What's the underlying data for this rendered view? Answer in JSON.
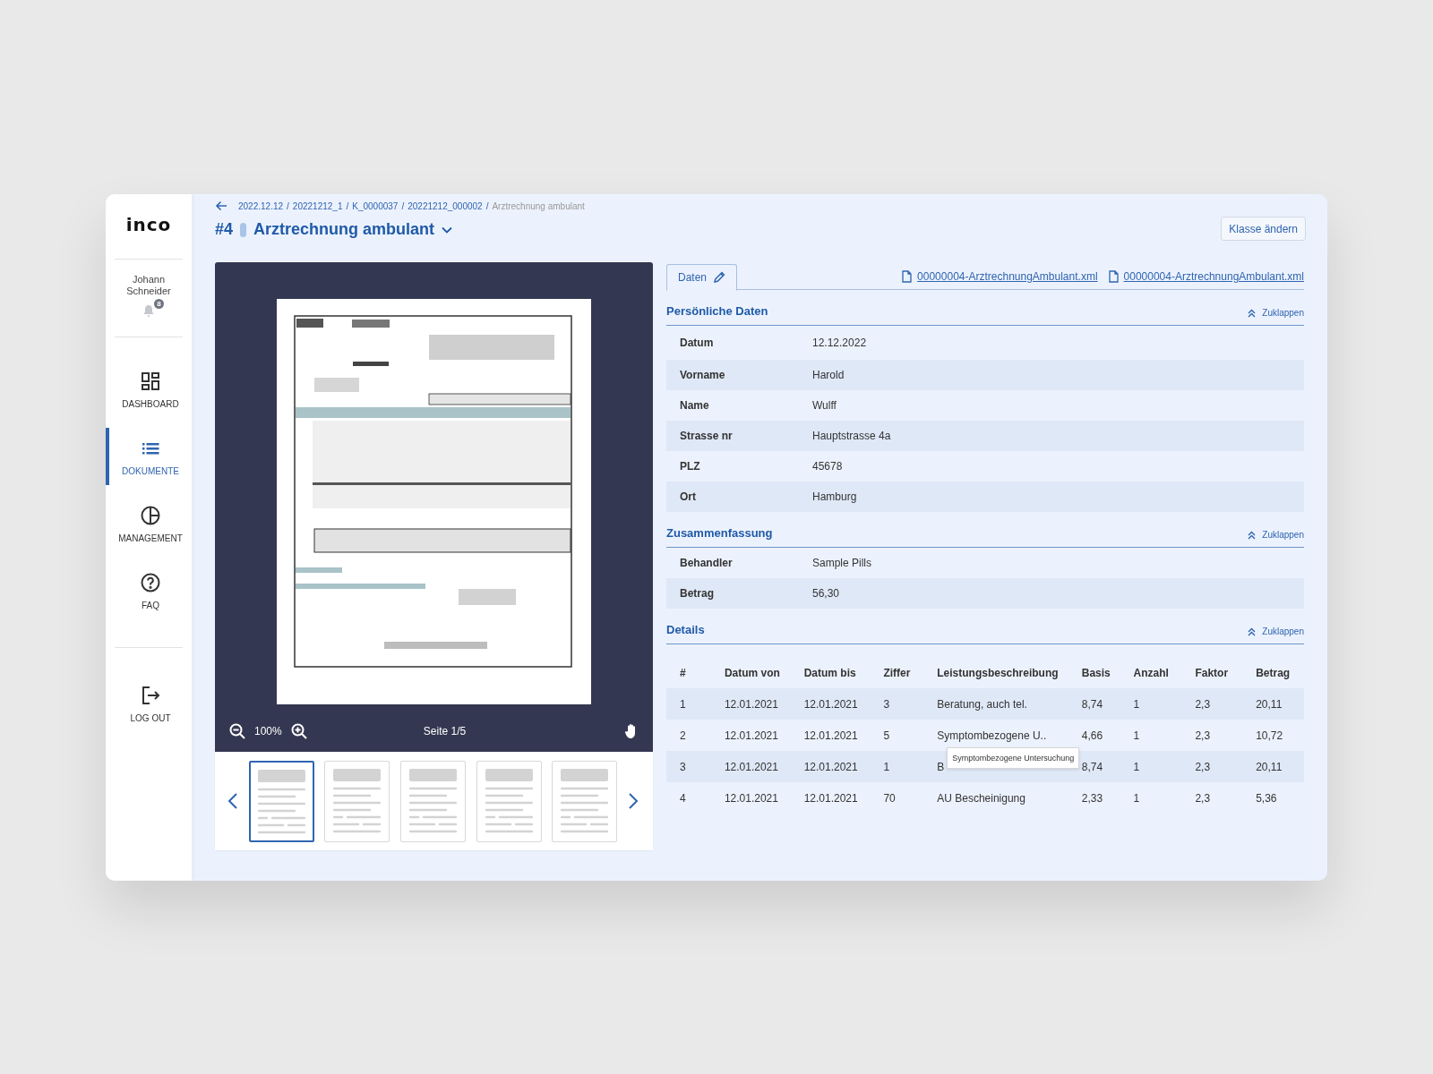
{
  "sidebar": {
    "logo": "inco",
    "user": {
      "name": "Johann Schneider",
      "notifications": "8"
    },
    "nav": [
      {
        "label": "DASHBOARD",
        "selected": false
      },
      {
        "label": "DOKUMENTE",
        "selected": true
      },
      {
        "label": "MANAGEMENT",
        "selected": false
      },
      {
        "label": "FAQ",
        "selected": false
      }
    ],
    "logout": {
      "label": "LOG OUT"
    }
  },
  "breadcrumb": {
    "links": [
      "2022.12.12",
      "20221212_1",
      "K_0000037",
      "20221212_000002"
    ],
    "separator": "/",
    "current": "Arztrechnung ambulant"
  },
  "title": {
    "number": "#4",
    "class": "Arztrechnung ambulant",
    "color": "#a9c4e8"
  },
  "class_button": "Klasse ändern",
  "viewer": {
    "zoom": "100%",
    "page": "Seite 1/5",
    "thumbnails": [
      {
        "selected": true
      },
      {
        "selected": false
      },
      {
        "selected": false
      },
      {
        "selected": false
      },
      {
        "selected": false
      }
    ]
  },
  "panel": {
    "tabs": [
      {
        "label": "Daten",
        "selected": true
      }
    ],
    "files": [
      "00000004-ArztrechnungAmbulant.xml",
      "00000004-ArztrechnungAmbulant.xml"
    ],
    "sections": [
      {
        "kind": "fields",
        "title": "Persönliche Daten",
        "toggle": "Zuklappen",
        "expanded": true,
        "rows": [
          {
            "label": "Datum",
            "value": "12.12.2022"
          },
          {
            "label": "Vorname",
            "value": "Harold"
          },
          {
            "label": "Name",
            "value": "Wulff"
          },
          {
            "label": "Strasse nr",
            "value": "Hauptstrasse 4a"
          },
          {
            "label": "PLZ",
            "value": "45678"
          },
          {
            "label": "Ort",
            "value": "Hamburg"
          }
        ]
      },
      {
        "kind": "fields",
        "title": "Zusammenfassung",
        "toggle": "Zuklappen",
        "expanded": true,
        "rows": [
          {
            "label": "Behandler",
            "value": "Sample Pills"
          },
          {
            "label": "Betrag",
            "value": "56,30"
          }
        ]
      },
      {
        "kind": "table",
        "title": "Details",
        "toggle": "Zuklappen",
        "expanded": true,
        "columns": [
          "#",
          "Datum von",
          "Datum bis",
          "Ziffer",
          "Leistungsbeschreibung",
          "Basis",
          "Anzahl",
          "Faktor",
          "Betrag"
        ],
        "rows": [
          {
            "cells": [
              "1",
              "12.01.2021",
              "12.01.2021",
              "3",
              "Beratung, auch tel.",
              "8,74",
              "1",
              "2,3",
              "20,11"
            ]
          },
          {
            "cells": [
              "2",
              "12.01.2021",
              "12.01.2021",
              "5",
              "Symptombezogene U..",
              "4,66",
              "1",
              "2,3",
              "10,72"
            ],
            "tooltip": "Symptombezogene Untersuchung"
          },
          {
            "cells": [
              "3",
              "12.01.2021",
              "12.01.2021",
              "1",
              "B",
              "8,74",
              "1",
              "2,3",
              "20,11"
            ]
          },
          {
            "cells": [
              "4",
              "12.01.2021",
              "12.01.2021",
              "70",
              "AU Bescheinigung",
              "2,33",
              "1",
              "2,3",
              "5,36"
            ]
          }
        ]
      }
    ]
  }
}
